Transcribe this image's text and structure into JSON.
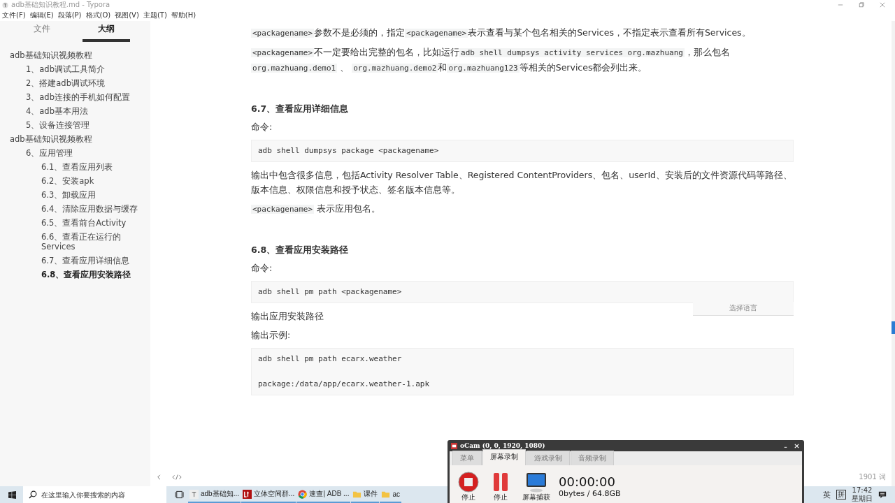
{
  "window": {
    "title": "adb基础知识教程.md - Typora"
  },
  "menu": [
    "文件(F)",
    "编辑(E)",
    "段落(P)",
    "格式(O)",
    "视图(V)",
    "主题(T)",
    "帮助(H)"
  ],
  "sidebar": {
    "tabs": [
      {
        "label": "文件",
        "selected": false
      },
      {
        "label": "大纲",
        "selected": true
      }
    ],
    "outline": [
      {
        "label": "adb基础知识视频教程",
        "selected": false,
        "children": [
          {
            "label": "1、adb调试工具简介",
            "selected": false
          },
          {
            "label": "2、搭建adb调试环境",
            "selected": false
          },
          {
            "label": "3、adb连接的手机如何配置",
            "selected": false
          },
          {
            "label": "4、adb基本用法",
            "selected": false
          },
          {
            "label": "5、设备连接管理",
            "selected": false
          }
        ]
      },
      {
        "label": "adb基础知识视频教程",
        "selected": false,
        "children": [
          {
            "label": "6、应用管理",
            "selected": false,
            "children": [
              {
                "label": "6.1、查看应用列表",
                "selected": false
              },
              {
                "label": "6.2、安装apk",
                "selected": false
              },
              {
                "label": "6.3、卸载应用",
                "selected": false
              },
              {
                "label": "6.4、清除应用数据与缓存",
                "selected": false
              },
              {
                "label": "6.5、查看前台Activity",
                "selected": false
              },
              {
                "label": "6.6、查看正在运行的Services",
                "selected": false
              },
              {
                "label": "6.7、查看应用详细信息",
                "selected": false
              },
              {
                "label": "6.8、查看应用安装路径",
                "selected": true
              }
            ]
          }
        ]
      }
    ]
  },
  "document": {
    "blocks": [
      {
        "kind": "paragraph",
        "segments": [
          {
            "kind": "code",
            "text": "<packagename>"
          },
          {
            "kind": "text",
            "text": "参数不是必须的，指定"
          },
          {
            "kind": "code",
            "text": "<packagename>"
          },
          {
            "kind": "text",
            "text": "表示查看与某个包名相关的Services，不指定表示查看所有Services。"
          }
        ]
      },
      {
        "kind": "paragraph",
        "segments": [
          {
            "kind": "code",
            "text": "<packagename>"
          },
          {
            "kind": "text",
            "text": "不一定要给出完整的包名，比如运行"
          },
          {
            "kind": "code",
            "text": "adb shell dumpsys activity services org.mazhuang"
          },
          {
            "kind": "text",
            "text": "，那么包名 "
          },
          {
            "kind": "code",
            "text": "org.mazhuang.demo1"
          },
          {
            "kind": "text",
            "text": " 、 "
          },
          {
            "kind": "code",
            "text": "org.mazhuang.demo2"
          },
          {
            "kind": "text",
            "text": "和"
          },
          {
            "kind": "code",
            "text": "org.mazhuang123"
          },
          {
            "kind": "text",
            "text": "等相关的Services都会列出来。"
          }
        ]
      },
      {
        "kind": "heading",
        "text": "6.7、查看应用详细信息"
      },
      {
        "kind": "paragraph",
        "segments": [
          {
            "kind": "text",
            "text": "命令:"
          }
        ]
      },
      {
        "kind": "code",
        "lines": [
          "adb shell dumpsys package <packagename>"
        ]
      },
      {
        "kind": "paragraph",
        "segments": [
          {
            "kind": "text",
            "text": "输出中包含很多信息，包括Activity Resolver Table、Registered ContentProviders、包名、userId、安装后的文件资源代码等路径、版本信息、权限信息和授予状态、签名版本信息等。"
          }
        ]
      },
      {
        "kind": "paragraph",
        "segments": [
          {
            "kind": "code",
            "text": "<packagename>"
          },
          {
            "kind": "text",
            "text": " 表示应用包名。"
          }
        ]
      },
      {
        "kind": "heading",
        "text": "6.8、查看应用安装路径"
      },
      {
        "kind": "paragraph",
        "segments": [
          {
            "kind": "text",
            "text": "命令:"
          }
        ]
      },
      {
        "kind": "code",
        "lines": [
          "adb shell pm path <packagename>"
        ],
        "language_hint": "选择语言"
      },
      {
        "kind": "paragraph",
        "segments": [
          {
            "kind": "text",
            "text": "输出应用安装路径"
          }
        ]
      },
      {
        "kind": "paragraph",
        "segments": [
          {
            "kind": "text",
            "text": "输出示例:"
          }
        ]
      },
      {
        "kind": "code",
        "groups": [
          [
            "adb shell pm path ecarx.weather"
          ],
          [
            "package:/data/app/ecarx.weather-1.apk"
          ]
        ]
      }
    ],
    "word_count": "1901 词"
  },
  "taskbar": {
    "search": {
      "placeholder": "在这里输入你要搜索的内容"
    },
    "apps": [
      {
        "label": "adb基础知...",
        "kind": "typora"
      },
      {
        "label": "立体空间群...",
        "kind": "lt"
      },
      {
        "label": "速查| ADB ...",
        "kind": "chrome"
      },
      {
        "label": "课件",
        "kind": "folder"
      },
      {
        "label": "ac",
        "kind": "folder"
      }
    ],
    "ime": "英",
    "ime_mode": "拼",
    "time": "17:42",
    "weekday": "星期日"
  },
  "ocam": {
    "title": "oCam (0, 0, 1920, 1080)",
    "tabs": [
      {
        "label": "菜单",
        "selected": false
      },
      {
        "label": "屏幕录制",
        "selected": true
      },
      {
        "label": "游戏录制",
        "selected": false
      },
      {
        "label": "音频录制",
        "selected": false
      }
    ],
    "buttons": [
      {
        "kind": "stop",
        "label": "停止"
      },
      {
        "kind": "pause",
        "label": "停止"
      },
      {
        "kind": "capture",
        "label": "屏幕捕获"
      }
    ],
    "timer": "00:00:00",
    "size": "0bytes / 64.8GB"
  }
}
